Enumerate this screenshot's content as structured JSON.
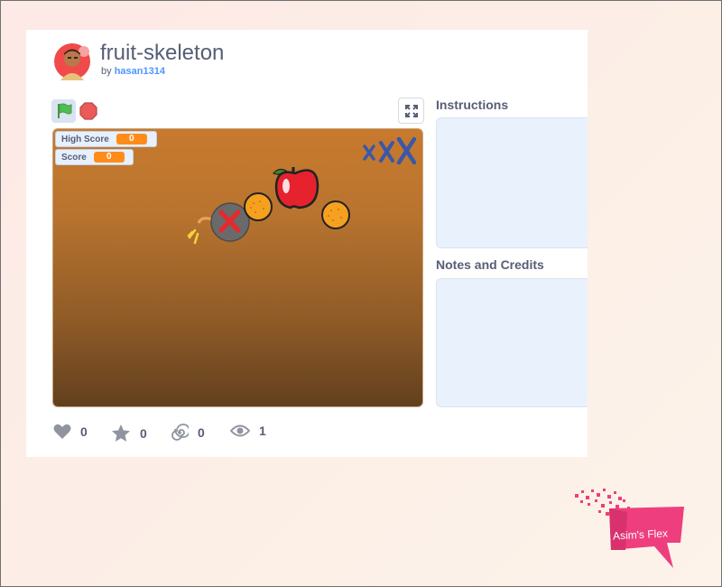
{
  "project": {
    "title": "fruit-skeleton",
    "by_prefix": "by",
    "author": "hasan1314"
  },
  "controls": {
    "green_flag_icon": "green-flag-icon",
    "stop_icon": "stop-sign-icon",
    "fullscreen_icon": "fullscreen-icon"
  },
  "stage": {
    "monitors": [
      {
        "label": "High Score",
        "value": "0"
      },
      {
        "label": "Score",
        "value": "0"
      }
    ],
    "misses_marks": "xXX",
    "sprites": [
      "bomb",
      "orange",
      "apple",
      "orange"
    ]
  },
  "panels": {
    "instructions_heading": "Instructions",
    "notes_heading": "Notes and Credits"
  },
  "stats": {
    "loves": "0",
    "favorites": "0",
    "remixes": "0",
    "views": "1"
  },
  "watermark": {
    "text": "Asim's Flex"
  },
  "colors": {
    "accent_blue": "#4c97ff",
    "text_gray": "#575e75",
    "monitor_orange": "#ff8c1a",
    "panel_bg": "#e9f1fc",
    "watermark_pink": "#ef3e7e"
  }
}
